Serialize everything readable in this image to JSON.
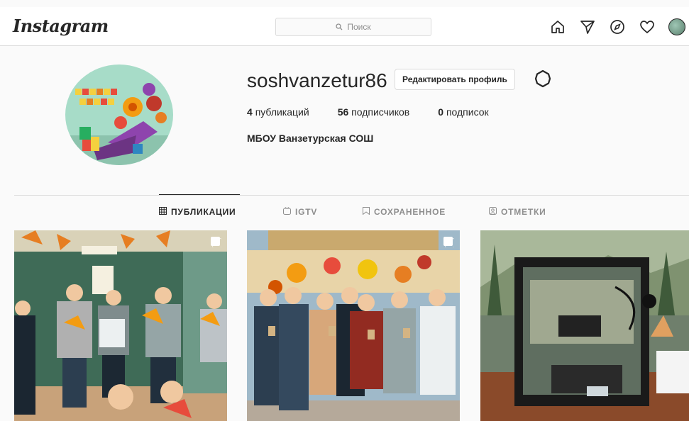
{
  "header": {
    "logo": "Instagram",
    "search_placeholder": "Поиск",
    "icons": [
      "home-icon",
      "direct-icon",
      "explore-icon",
      "activity-heart-icon",
      "profile-avatar"
    ]
  },
  "profile": {
    "username": "soshvanzetur86",
    "edit_button": "Редактировать профиль",
    "stats": [
      {
        "count": "4",
        "label": "публикаций"
      },
      {
        "count": "56",
        "label": "подписчиков"
      },
      {
        "count": "0",
        "label": "подписок"
      }
    ],
    "full_name": "МБОУ Ванзетурская СОШ"
  },
  "tabs": [
    {
      "label": "ПУБЛИКАЦИИ",
      "icon": "grid-icon",
      "active": true
    },
    {
      "label": "IGTV",
      "icon": "igtv-icon",
      "active": false
    },
    {
      "label": "СОХРАНЕННОЕ",
      "icon": "bookmark-icon",
      "active": false
    },
    {
      "label": "ОТМЕТКИ",
      "icon": "tagged-icon",
      "active": false
    }
  ],
  "posts": [
    {
      "type": "carousel"
    },
    {
      "type": "carousel"
    },
    {
      "type": "single"
    }
  ],
  "colors": {
    "background": "#fafafa",
    "border": "#dbdbdb",
    "text": "#262626",
    "muted": "#8e8e8e"
  }
}
